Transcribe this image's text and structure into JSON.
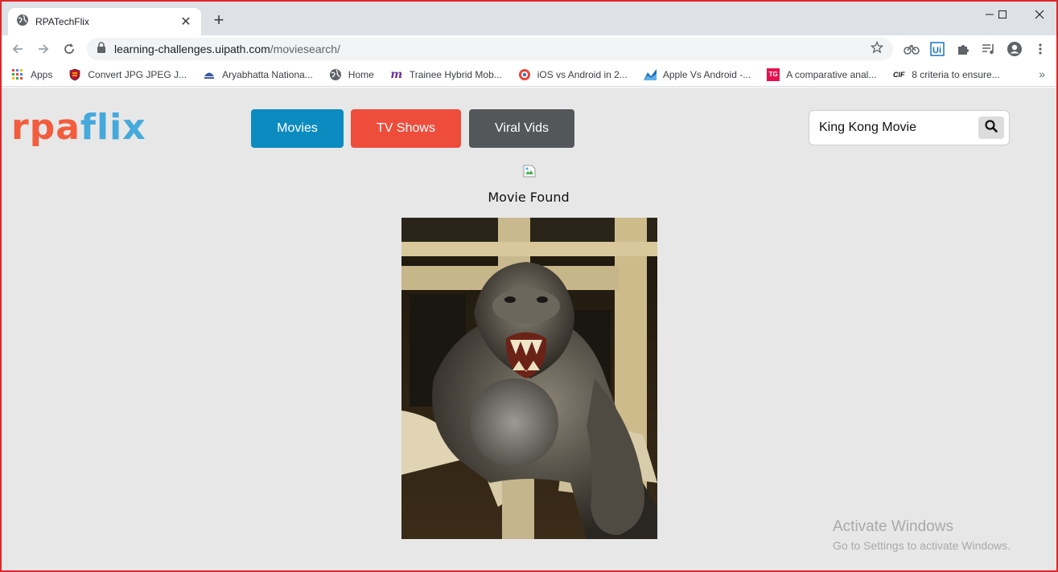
{
  "browser": {
    "tab_title": "RPATechFlix",
    "new_tab": "+",
    "url_host": "learning-challenges.uipath.com",
    "url_path": "/moviesearch/",
    "bookmarks": [
      {
        "label": "Apps",
        "icon": "apps-grid-icon"
      },
      {
        "label": "Convert JPG JPEG J...",
        "icon": "shield-icon"
      },
      {
        "label": "Aryabhatta Nationa...",
        "icon": "emblem-icon"
      },
      {
        "label": "Home",
        "icon": "globe-icon"
      },
      {
        "label": "Trainee Hybrid Mob...",
        "icon": "m-logo-icon"
      },
      {
        "label": "iOS vs Android in 2...",
        "icon": "circle-logo-icon"
      },
      {
        "label": "Apple Vs Android -...",
        "icon": "chart-logo-icon"
      },
      {
        "label": "A comparative anal...",
        "icon": "tg-logo-icon"
      },
      {
        "label": "8 criteria to ensure...",
        "icon": "cif-logo-icon"
      }
    ],
    "bookmarks_more": "»"
  },
  "site": {
    "logo_rpa": "rpa",
    "logo_flix": "flix",
    "nav": {
      "movies": "Movies",
      "tv_shows": "TV Shows",
      "viral_vids": "Viral Vids"
    },
    "colors": {
      "movies": "#0c8bc0",
      "tv_shows": "#ef4d3c",
      "viral_vids": "#545759",
      "logo_rpa": "#f25d3e",
      "logo_flix": "#45a9dc"
    },
    "search": {
      "value": "King Kong Movie"
    },
    "result_text": "Movie Found"
  },
  "os": {
    "activate_title": "Activate Windows",
    "activate_sub": "Go to Settings to activate Windows."
  }
}
